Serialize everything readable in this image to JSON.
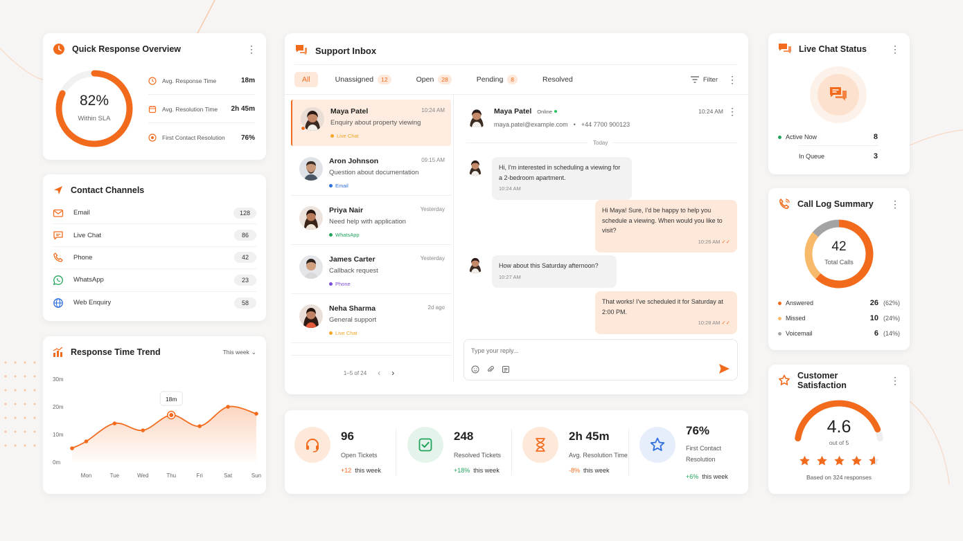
{
  "quick_response": {
    "title": "Quick Response Overview",
    "gauge_value": "82%",
    "gauge_label": "Within SLA",
    "gauge_fraction": 0.82,
    "metrics": [
      {
        "label": "Avg. Response Time",
        "value": "18m",
        "icon": "clock-icon"
      },
      {
        "label": "Avg. Resolution Time",
        "value": "2h 45m",
        "icon": "calendar-icon"
      },
      {
        "label": "First Contact Resolution",
        "value": "76%",
        "icon": "target-icon"
      }
    ]
  },
  "contact_channels": {
    "title": "Contact Channels",
    "items": [
      {
        "label": "Email",
        "count": "128",
        "icon": "mail-icon"
      },
      {
        "label": "Live Chat",
        "count": "86",
        "icon": "chat-icon"
      },
      {
        "label": "Phone",
        "count": "42",
        "icon": "phone-icon"
      },
      {
        "label": "WhatsApp",
        "count": "23",
        "icon": "whatsapp-icon"
      },
      {
        "label": "Web Enquiry",
        "count": "58",
        "icon": "globe-icon"
      }
    ]
  },
  "chart_data": {
    "type": "area",
    "title": "Response Time Trend",
    "period_selector": "This week",
    "categories": [
      "Mon",
      "Tue",
      "Wed",
      "Thu",
      "Fri",
      "Sat",
      "Sun"
    ],
    "x": [
      0,
      0.5,
      1.5,
      2.5,
      3.5,
      4.5,
      5.5,
      6.5
    ],
    "y_ticks": [
      "30m",
      "20m",
      "10m",
      "0m"
    ],
    "ylim": [
      0,
      30
    ],
    "points": [
      [
        0,
        5
      ],
      [
        0.5,
        7.5
      ],
      [
        1.5,
        14
      ],
      [
        2.5,
        11.5
      ],
      [
        3.5,
        17
      ],
      [
        4.5,
        13
      ],
      [
        5.5,
        20
      ],
      [
        6.5,
        17.5
      ]
    ],
    "highlight_index": 4,
    "tooltip": "18m",
    "grid": false,
    "color": "#f26b1d"
  },
  "inbox": {
    "title": "Support Inbox",
    "tabs": [
      {
        "label": "All",
        "count": ""
      },
      {
        "label": "Unassigned",
        "count": "12"
      },
      {
        "label": "Open",
        "count": "28"
      },
      {
        "label": "Pending",
        "count": "8"
      },
      {
        "label": "Resolved",
        "count": ""
      }
    ],
    "filter_label": "Filter",
    "conversations": [
      {
        "name": "Maya Patel",
        "time": "10:24 AM",
        "subject": "Enquiry about property viewing",
        "channel": "Live Chat",
        "channel_color": "#f5a623"
      },
      {
        "name": "Aron Johnson",
        "time": "09:15 AM",
        "subject": "Question about documentation",
        "channel": "Email",
        "channel_color": "#2f6fde"
      },
      {
        "name": "Priya Nair",
        "time": "Yesterday",
        "subject": "Need help with application",
        "channel": "WhatsApp",
        "channel_color": "#22a45d"
      },
      {
        "name": "James Carter",
        "time": "Yesterday",
        "subject": "Callback request",
        "channel": "Phone",
        "channel_color": "#7b4fd6"
      },
      {
        "name": "Neha Sharma",
        "time": "2d ago",
        "subject": "General support",
        "channel": "Live Chat",
        "channel_color": "#f5a623"
      }
    ],
    "pagination": "1–5 of 24",
    "chat": {
      "name": "Maya Patel",
      "status": "Online",
      "email": "maya.patel@example.com",
      "phone": "+44 7700 900123",
      "time": "10:24 AM",
      "day_divider": "Today",
      "messages": [
        {
          "dir": "in",
          "text": "Hi, I'm interested in scheduling a viewing for a 2-bedroom apartment.",
          "time": "10:24 AM"
        },
        {
          "dir": "out",
          "text": "Hi Maya! Sure, I'd be happy to help you schedule a viewing. When would you like to visit?",
          "time": "10:26 AM"
        },
        {
          "dir": "in",
          "text": "How about this Saturday afternoon?",
          "time": "10:27 AM"
        },
        {
          "dir": "out",
          "text": "That works! I've scheduled it for Saturday at 2:00 PM.",
          "time": "10:28 AM"
        }
      ],
      "reply_placeholder": "Type your reply..."
    }
  },
  "stats": [
    {
      "value": "96",
      "label": "Open Tickets",
      "delta": "+12",
      "delta_suffix": "this week",
      "icon": "headset-icon"
    },
    {
      "value": "248",
      "label": "Resolved Tickets",
      "delta": "+18%",
      "delta_suffix": "this week",
      "icon": "check-square-icon"
    },
    {
      "value": "2h 45m",
      "label": "Avg. Resolution Time",
      "delta": "-8%",
      "delta_suffix": "this week",
      "icon": "hourglass-icon"
    },
    {
      "value": "76%",
      "label_line1": "First Contact",
      "label_line2": "Resolution",
      "delta": "+6%",
      "delta_suffix": "this week",
      "icon": "star-icon"
    }
  ],
  "live_chat": {
    "title": "Live Chat Status",
    "rows": [
      {
        "label": "Active Now",
        "value": "8"
      },
      {
        "label": "In Queue",
        "value": "3"
      }
    ]
  },
  "call_log": {
    "title": "Call Log Summary",
    "total": "42",
    "total_label": "Total Calls",
    "segments": [
      {
        "label": "Answered",
        "value": "26",
        "pct": "(62%)",
        "color": "#f26b1d",
        "fraction": 0.62
      },
      {
        "label": "Missed",
        "value": "10",
        "pct": "(24%)",
        "color": "#f7b96a",
        "fraction": 0.24
      },
      {
        "label": "Voicemail",
        "value": "6",
        "pct": "(14%)",
        "color": "#a3a3a3",
        "fraction": 0.14
      }
    ]
  },
  "satisfaction": {
    "title": "Customer Satisfaction",
    "score": "4.6",
    "out_of": "out of 5",
    "fraction": 0.92,
    "stars": 4.6,
    "note": "Based on 324 responses"
  },
  "colors": {
    "accent": "#f26b1d",
    "accent_light": "#fde8da",
    "green": "#22a45d",
    "blue": "#2f6fde"
  }
}
